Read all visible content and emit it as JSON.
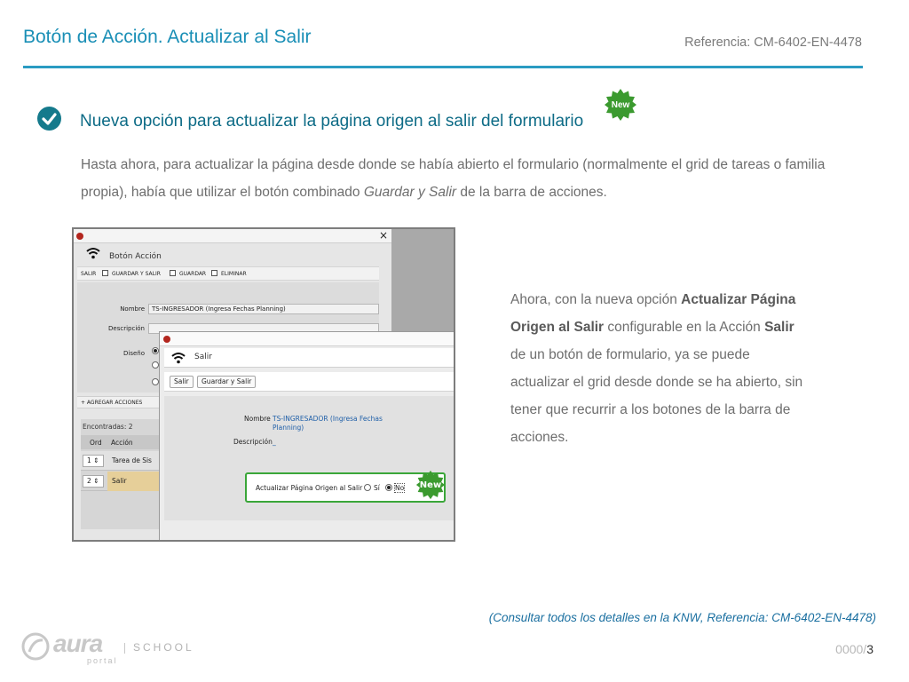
{
  "header": {
    "title": "Botón de Acción. Actualizar al Salir",
    "reference": "Referencia: CM-6402-EN-4478"
  },
  "section": {
    "heading": "Nueva opción para actualizar la página origen al salir del formulario",
    "badge": "New",
    "intro_part1": "Hasta ahora, para actualizar la página desde donde se había abierto el formulario (normalmente el grid de tareas o familia propia), había que utilizar el botón combinado ",
    "intro_em": "Guardar y Salir",
    "intro_part2": " de la barra de acciones."
  },
  "side_text": {
    "p1": "Ahora, con la nueva opción ",
    "b1": "Actualizar Página Origen al Salir",
    "p2": " configurable en la Acción ",
    "b2": "Salir",
    "p3": " de un botón de formulario, ya se puede actualizar el grid desde donde se ha abierto, sin tener que recurrir a los botones de la barra de acciones."
  },
  "screenshot": {
    "window1": {
      "title": "Botón Acción",
      "close": "×",
      "toolbar": [
        "SALIR",
        "GUARDAR Y SALIR",
        "GUARDAR",
        "ELIMINAR"
      ],
      "fields": {
        "nombre_label": "Nombre",
        "nombre_value": "TS-INGRESADOR (Ingresa Fechas Planning)",
        "descripcion_label": "Descripción",
        "diseno_label": "Diseño"
      },
      "add_actions": "+ AGREGAR ACCIONES",
      "grid": {
        "count": "Encontradas: 2",
        "columns": [
          "Ord",
          "Acción"
        ],
        "rows": [
          {
            "ord": "1",
            "name": "Tarea de Sis"
          },
          {
            "ord": "2",
            "name": "Salir"
          }
        ]
      }
    },
    "window2": {
      "title": "Salir",
      "buttons": [
        "Salir",
        "Guardar y Salir"
      ],
      "nombre_label": "Nombre",
      "nombre_value": "TS-INGRESADOR (Ingresa Fechas Planning)",
      "descripcion_label": "Descripción",
      "descripcion_value": "_",
      "option_label": "Actualizar Página Origen al Salir",
      "option_yes": "Sí",
      "option_no": "No",
      "selected": "No",
      "badge": "New"
    }
  },
  "footer": {
    "note": "(Consultar todos los detalles en la KNW, Referencia: CM-6402-EN-4478)",
    "logo_word": "aura",
    "logo_sub": "portal",
    "logo_school": "SCHOOL",
    "page_prefix": "0000/",
    "page_number": "3"
  },
  "colors": {
    "title": "#1a8fb6",
    "rule": "#2a9bc2",
    "heading": "#0d6b86",
    "badge_green": "#3b9a2f",
    "highlight_green": "#3aa639"
  }
}
